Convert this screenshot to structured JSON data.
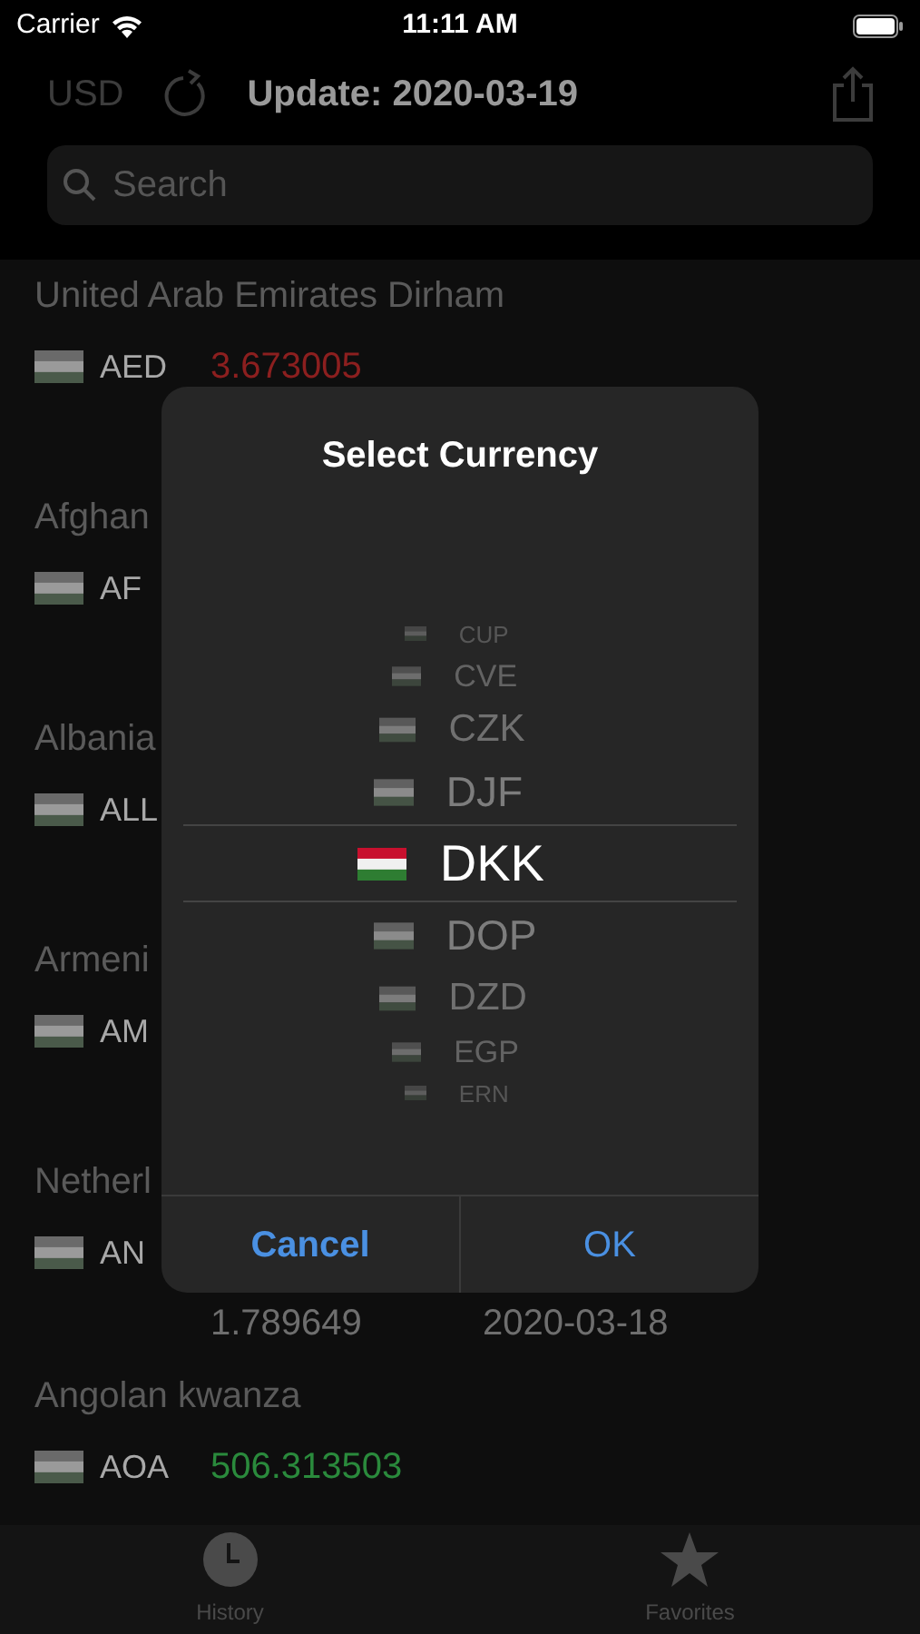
{
  "status_bar": {
    "carrier": "Carrier",
    "time": "11:11 AM"
  },
  "nav": {
    "base": "USD",
    "title": "Update: 2020-03-19"
  },
  "search": {
    "placeholder": "Search"
  },
  "rows": [
    {
      "name": "United Arab Emirates Dirham",
      "code": "AED",
      "rate": "3.673005",
      "color": "#8c1f1f"
    },
    {
      "name": "Afghan",
      "code": "AF"
    },
    {
      "name": "Albania",
      "code": "ALL"
    },
    {
      "name": "Armeni",
      "code": "AM"
    },
    {
      "name": "Netherl",
      "code": "AN",
      "detail": {
        "rate": "1.789649",
        "date": "2020-03-18"
      }
    },
    {
      "name": "Angolan kwanza",
      "code": "AOA",
      "rate": "506.313503",
      "color": "#2a8a3c"
    }
  ],
  "dialog": {
    "title": "Select Currency",
    "options": [
      {
        "code": "CUP",
        "selected": false
      },
      {
        "code": "CVE",
        "selected": false
      },
      {
        "code": "CZK",
        "selected": false
      },
      {
        "code": "DJF",
        "selected": false
      },
      {
        "code": "DKK",
        "selected": true
      },
      {
        "code": "DOP",
        "selected": false
      },
      {
        "code": "DZD",
        "selected": false
      },
      {
        "code": "EGP",
        "selected": false
      },
      {
        "code": "ERN",
        "selected": false
      }
    ],
    "buttons": [
      "Cancel",
      "OK"
    ]
  },
  "tab_bar": [
    {
      "label": "History",
      "kind": "clock"
    },
    {
      "label": "Favorites",
      "kind": "star"
    }
  ]
}
